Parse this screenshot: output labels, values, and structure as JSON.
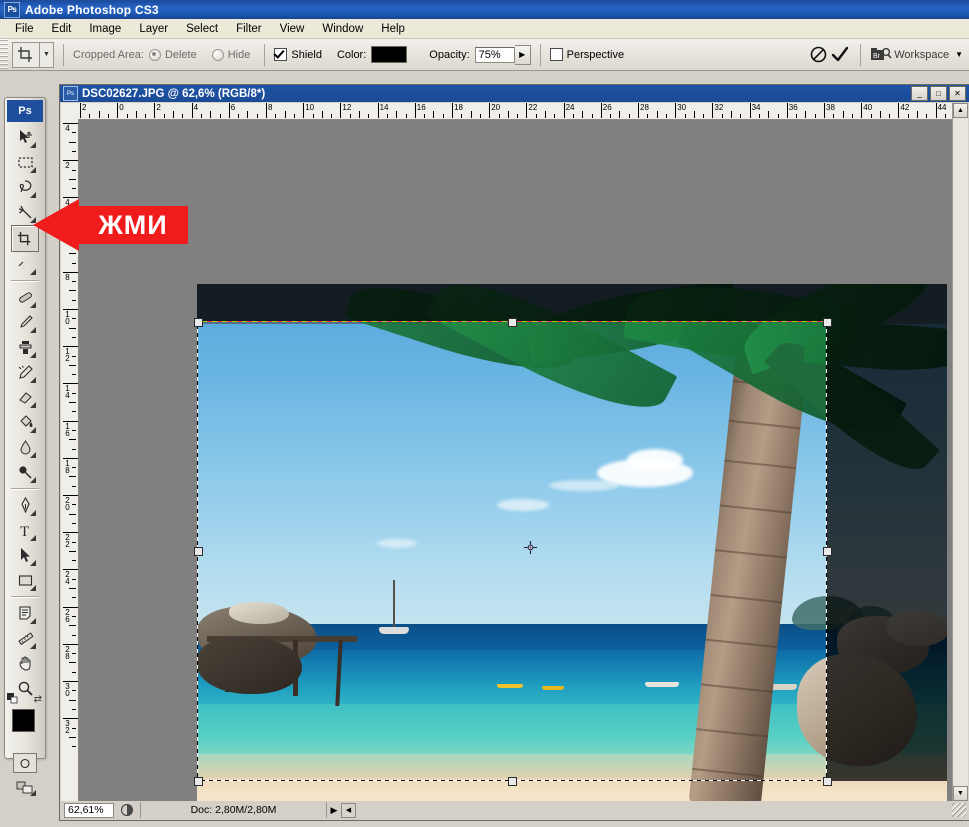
{
  "window": {
    "app_title": "Adobe Photoshop CS3",
    "app_badge": "Ps"
  },
  "menu": {
    "items": [
      {
        "label": "File"
      },
      {
        "label": "Edit"
      },
      {
        "label": "Image"
      },
      {
        "label": "Layer"
      },
      {
        "label": "Select"
      },
      {
        "label": "Filter"
      },
      {
        "label": "View"
      },
      {
        "label": "Window"
      },
      {
        "label": "Help"
      }
    ]
  },
  "options_bar": {
    "active_tool": "crop-tool",
    "cropped_area_label": "Cropped Area:",
    "delete_label": "Delete",
    "delete_selected": true,
    "hide_label": "Hide",
    "hide_selected": false,
    "shield_label": "Shield",
    "shield_checked": true,
    "color_label": "Color:",
    "color_value": "#000000",
    "opacity_label": "Opacity:",
    "opacity_value": "75%",
    "perspective_label": "Perspective",
    "perspective_checked": false,
    "cancel_title": "Cancel current crop",
    "commit_title": "Commit current crop",
    "bridge_title": "Go to Bridge",
    "workspace_label": "Workspace"
  },
  "toolbox": {
    "tools": [
      {
        "name": "move-tool",
        "glyph": "move"
      },
      {
        "name": "rectangular-marquee-tool",
        "glyph": "marquee"
      },
      {
        "name": "lasso-tool",
        "glyph": "lasso"
      },
      {
        "name": "magic-wand-tool",
        "glyph": "wand"
      },
      {
        "name": "crop-tool",
        "glyph": "crop",
        "selected": true
      },
      {
        "name": "slice-tool",
        "glyph": "slice"
      },
      {
        "name": "healing-brush-tool",
        "glyph": "healing"
      },
      {
        "name": "brush-tool",
        "glyph": "brush"
      },
      {
        "name": "clone-stamp-tool",
        "glyph": "stamp"
      },
      {
        "name": "history-brush-tool",
        "glyph": "history"
      },
      {
        "name": "eraser-tool",
        "glyph": "eraser"
      },
      {
        "name": "gradient-tool",
        "glyph": "bucket"
      },
      {
        "name": "blur-tool",
        "glyph": "blur"
      },
      {
        "name": "dodge-tool",
        "glyph": "dodge"
      },
      {
        "name": "pen-tool",
        "glyph": "pen"
      },
      {
        "name": "horizontal-type-tool",
        "glyph": "type"
      },
      {
        "name": "path-selection-tool",
        "glyph": "pathsel"
      },
      {
        "name": "rectangle-tool",
        "glyph": "shape"
      },
      {
        "name": "notes-tool",
        "glyph": "notes"
      },
      {
        "name": "eyedropper-tool",
        "glyph": "ruler"
      },
      {
        "name": "hand-tool",
        "glyph": "hand"
      },
      {
        "name": "zoom-tool",
        "glyph": "zoom"
      }
    ],
    "foreground_color": "#000000",
    "background_color": "#ffffff",
    "quick_mask_label": "Edit in Quick Mask Mode",
    "screen_mode_label": "Change Screen Mode"
  },
  "document": {
    "title": "DSC02627.JPG @ 62,6% (RGB/8*)",
    "minimize_label": "_",
    "maximize_label": "□",
    "close_label": "✕",
    "ruler_h_labels": [
      "2",
      "0",
      "2",
      "4",
      "6",
      "8",
      "10",
      "12",
      "14",
      "16",
      "18",
      "20",
      "22",
      "24",
      "26",
      "28",
      "30",
      "32",
      "34",
      "36",
      "38",
      "40",
      "42",
      "44"
    ],
    "ruler_v_labels": [
      "4",
      "2",
      "4",
      "6",
      "8",
      "10",
      "12",
      "14",
      "16",
      "18",
      "20",
      "22",
      "24",
      "26",
      "28",
      "30",
      "32"
    ],
    "ruler_units": "cm"
  },
  "status_bar": {
    "zoom_value": "62,61%",
    "doc_info": "Doc: 2,80M/2,80M",
    "play_glyph": "▶",
    "arrow_glyph": "◀"
  },
  "annotation": {
    "text": "ЖМИ",
    "color": "#f01b1b",
    "points_to": "crop-tool"
  },
  "image_content": {
    "scene": "tropical beach with palm tree, turquoise sea, boats, pier and rocks"
  }
}
